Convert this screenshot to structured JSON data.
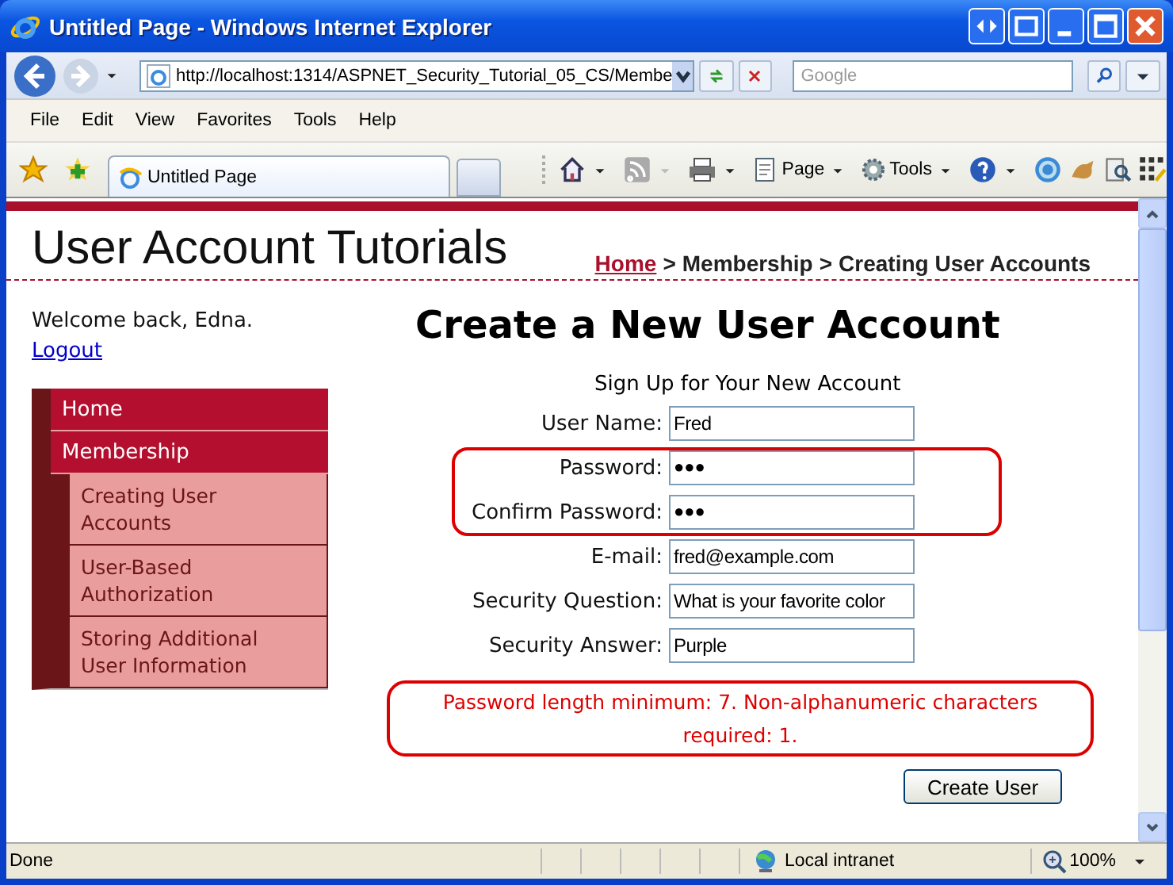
{
  "window": {
    "title": "Untitled Page - Windows Internet Explorer"
  },
  "address_bar": {
    "url": "http://localhost:1314/ASPNET_Security_Tutorial_05_CS/Membe"
  },
  "search": {
    "placeholder": "Google"
  },
  "menu": [
    "File",
    "Edit",
    "View",
    "Favorites",
    "Tools",
    "Help"
  ],
  "tabs": [
    {
      "label": "Untitled Page",
      "selected": true
    }
  ],
  "command_bar": [
    "Page",
    "Tools"
  ],
  "page": {
    "site_title": "User Account Tutorials",
    "breadcrumb": [
      {
        "label": "Home",
        "link": true
      },
      {
        "label": "Membership",
        "link": false
      },
      {
        "label": "Creating User Accounts",
        "link": false
      }
    ],
    "breadcrumb_separator": ">",
    "welcome": "Welcome back, Edna.",
    "logout": "Logout",
    "nav": [
      {
        "label": "Home"
      },
      {
        "label": "Membership",
        "children": [
          {
            "label": "Creating User Accounts"
          },
          {
            "label": "User-Based Authorization"
          },
          {
            "label": "Storing Additional User Information"
          }
        ]
      }
    ],
    "heading": "Create a New User Account",
    "form": {
      "caption": "Sign Up for Your New Account",
      "row_groups": [
        {
          "highlighted": false,
          "rows": [
            {
              "label": "User Name:",
              "value": "Fred"
            }
          ]
        },
        {
          "highlighted": true,
          "rows": [
            {
              "label": "Password:",
              "value": "●●●"
            },
            {
              "label": "Confirm Password:",
              "value": "●●●"
            }
          ]
        },
        {
          "highlighted": false,
          "rows": [
            {
              "label": "E-mail:",
              "value": "fred@example.com"
            },
            {
              "label": "Security Question:",
              "value": "What is your favorite color"
            },
            {
              "label": "Security Answer:",
              "value": "Purple"
            }
          ]
        }
      ],
      "error": {
        "text": "Password length minimum: 7. Non-alphanumeric characters required: 1.",
        "highlighted": true
      },
      "submit": "Create User"
    }
  },
  "status_bar": {
    "text": "Done",
    "zone": "Local intranet",
    "zoom": "100%"
  }
}
